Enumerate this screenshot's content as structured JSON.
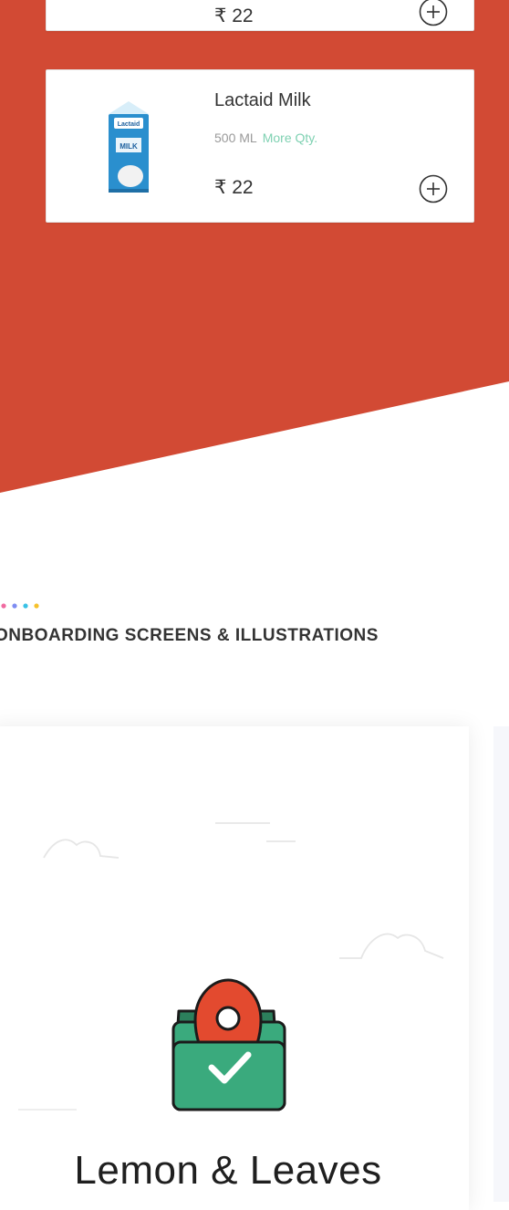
{
  "colors": {
    "brand_red": "#d24a34",
    "accent_green": "#7fd1b2",
    "bag_green": "#3aaa7d",
    "pin_red": "#e34a2f",
    "dot_colors": [
      "#f06aa0",
      "#7e8cf2",
      "#38c1e6",
      "#f6c12b"
    ]
  },
  "products": [
    {
      "image_icon": "milk-carton-icon",
      "price": "₹ 22"
    },
    {
      "name": "Lactaid Milk",
      "quantity": "500 ML",
      "more_link": "More Qty.",
      "price": "₹ 22",
      "image_icon": "milk-carton-icon",
      "carton_label": "Lactaid",
      "carton_text": "MILK"
    }
  ],
  "section": {
    "title": "ONBOARDING SCREENS & ILLUSTRATIONS"
  },
  "onboarding": {
    "icons": [
      "location-pin-icon",
      "shopping-bag-icon",
      "checkmark-icon",
      "cloud-icon"
    ],
    "brand_name": "Lemon & Leaves"
  }
}
